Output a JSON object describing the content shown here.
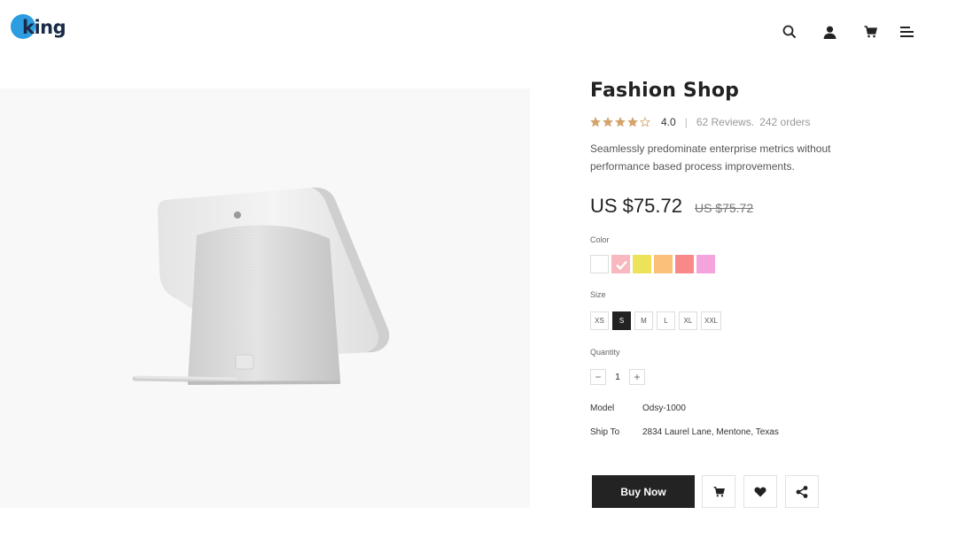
{
  "brand": {
    "logo_text": "king"
  },
  "header": {
    "icons": [
      "search-icon",
      "user-icon",
      "cart-icon",
      "menu-icon"
    ]
  },
  "product": {
    "title": "Fashion Shop",
    "rating_value": "4.0",
    "rating_stars": 4,
    "rating_max": 5,
    "separator": "|",
    "reviews": "62 Reviews.",
    "orders": "242 orders",
    "description": "Seamlessly predominate enterprise metrics without performance based process improvements.",
    "price": "US $75.72",
    "old_price": "US $75.72",
    "color_label": "Color",
    "colors": [
      "#ffffff",
      "#f7b8bf",
      "#ece35a",
      "#fbc17a",
      "#f98989",
      "#f5a3dc"
    ],
    "selected_color_index": 1,
    "size_label": "Size",
    "sizes": [
      "XS",
      "S",
      "M",
      "L",
      "XL",
      "XXL"
    ],
    "selected_size_index": 1,
    "quantity_label": "Quantity",
    "quantity_minus": "−",
    "quantity": "1",
    "quantity_plus": "+",
    "model_label": "Model",
    "model": "Odsy-1000",
    "ship_label": "Ship To",
    "ship_to": "2834  Laurel Lane, Mentone, Texas",
    "buy_label": "Buy Now"
  },
  "colors": {
    "accent": "#232323",
    "star": "#d3a36a",
    "panel_bg": "#f8f8f8"
  }
}
